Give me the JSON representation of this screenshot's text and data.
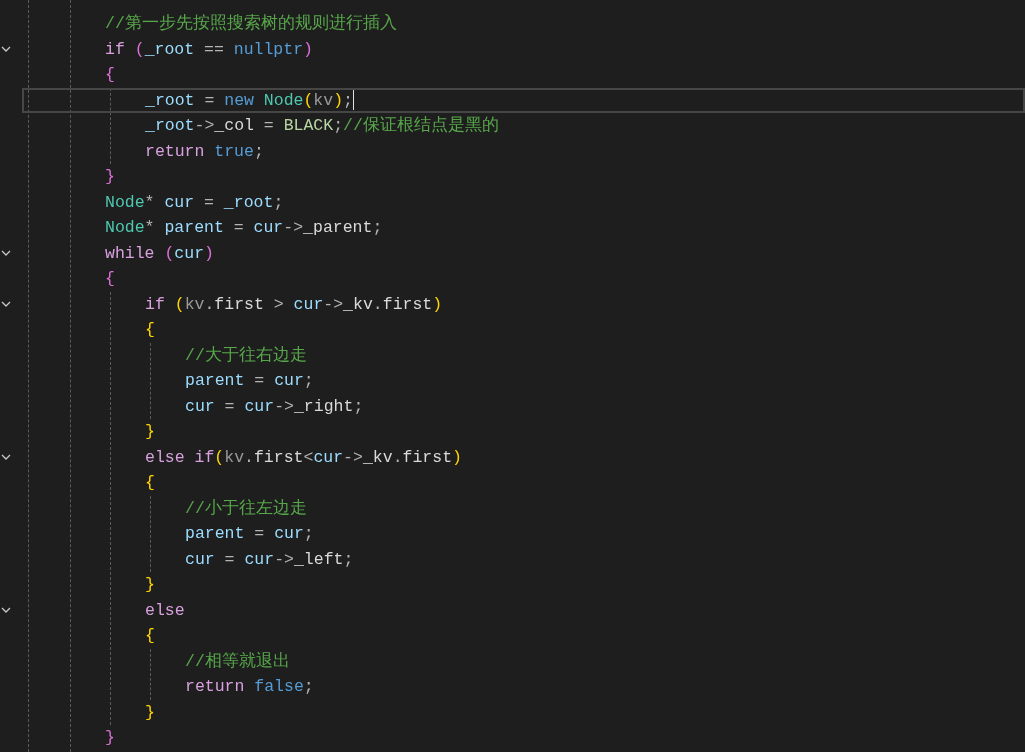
{
  "lines": [
    {
      "fold": false,
      "current": false,
      "tokens": [
        {
          "kind": "comment",
          "text": "//第一步先按照搜索树的规则进行插入"
        }
      ]
    },
    {
      "fold": true,
      "current": false,
      "tokens": [
        {
          "kind": "control",
          "text": "if "
        },
        {
          "kind": "bracket1",
          "text": "("
        },
        {
          "kind": "variable",
          "text": "_root"
        },
        {
          "kind": "punct",
          "text": " == "
        },
        {
          "kind": "keyword",
          "text": "nullptr"
        },
        {
          "kind": "bracket1",
          "text": ")"
        }
      ]
    },
    {
      "fold": false,
      "current": false,
      "tokens": [
        {
          "kind": "bracket1",
          "text": "{"
        }
      ],
      "children": [
        {
          "fold": false,
          "current": true,
          "tokens": [
            {
              "kind": "variable",
              "text": "_root"
            },
            {
              "kind": "punct",
              "text": " = "
            },
            {
              "kind": "keyword",
              "text": "new "
            },
            {
              "kind": "type",
              "text": "Node"
            },
            {
              "kind": "bracket2",
              "text": "("
            },
            {
              "kind": "param",
              "text": "kv"
            },
            {
              "kind": "bracket2",
              "text": ")"
            },
            {
              "kind": "punct",
              "text": ";"
            }
          ]
        },
        {
          "fold": false,
          "current": false,
          "tokens": [
            {
              "kind": "variable",
              "text": "_root"
            },
            {
              "kind": "punct",
              "text": "->"
            },
            {
              "kind": "member",
              "text": "_col"
            },
            {
              "kind": "punct",
              "text": " = "
            },
            {
              "kind": "enum",
              "text": "BLACK"
            },
            {
              "kind": "punct",
              "text": ";"
            },
            {
              "kind": "comment",
              "text": "//保证根结点是黑的"
            }
          ]
        },
        {
          "fold": false,
          "current": false,
          "tokens": [
            {
              "kind": "control",
              "text": "return "
            },
            {
              "kind": "keyword",
              "text": "true"
            },
            {
              "kind": "punct",
              "text": ";"
            }
          ]
        }
      ]
    },
    {
      "fold": false,
      "current": false,
      "tokens": [
        {
          "kind": "bracket1",
          "text": "}"
        }
      ]
    },
    {
      "fold": false,
      "current": false,
      "tokens": [
        {
          "kind": "type",
          "text": "Node"
        },
        {
          "kind": "punct",
          "text": "* "
        },
        {
          "kind": "variable",
          "text": "cur"
        },
        {
          "kind": "punct",
          "text": " = "
        },
        {
          "kind": "variable",
          "text": "_root"
        },
        {
          "kind": "punct",
          "text": ";"
        }
      ]
    },
    {
      "fold": false,
      "current": false,
      "tokens": [
        {
          "kind": "type",
          "text": "Node"
        },
        {
          "kind": "punct",
          "text": "* "
        },
        {
          "kind": "variable",
          "text": "parent"
        },
        {
          "kind": "punct",
          "text": " = "
        },
        {
          "kind": "variable",
          "text": "cur"
        },
        {
          "kind": "punct",
          "text": "->"
        },
        {
          "kind": "member",
          "text": "_parent"
        },
        {
          "kind": "punct",
          "text": ";"
        }
      ]
    },
    {
      "fold": true,
      "current": false,
      "tokens": [
        {
          "kind": "control",
          "text": "while "
        },
        {
          "kind": "bracket1",
          "text": "("
        },
        {
          "kind": "variable",
          "text": "cur"
        },
        {
          "kind": "bracket1",
          "text": ")"
        }
      ]
    },
    {
      "fold": false,
      "current": false,
      "tokens": [
        {
          "kind": "bracket1",
          "text": "{"
        }
      ],
      "children": [
        {
          "fold": true,
          "current": false,
          "tokens": [
            {
              "kind": "control",
              "text": "if "
            },
            {
              "kind": "bracket2",
              "text": "("
            },
            {
              "kind": "param",
              "text": "kv"
            },
            {
              "kind": "punct",
              "text": "."
            },
            {
              "kind": "member",
              "text": "first"
            },
            {
              "kind": "punct",
              "text": " > "
            },
            {
              "kind": "variable",
              "text": "cur"
            },
            {
              "kind": "punct",
              "text": "->"
            },
            {
              "kind": "member",
              "text": "_kv"
            },
            {
              "kind": "punct",
              "text": "."
            },
            {
              "kind": "member",
              "text": "first"
            },
            {
              "kind": "bracket2",
              "text": ")"
            }
          ]
        },
        {
          "fold": false,
          "current": false,
          "tokens": [
            {
              "kind": "bracket2",
              "text": "{"
            }
          ],
          "children": [
            {
              "fold": false,
              "current": false,
              "tokens": [
                {
                  "kind": "comment",
                  "text": "//大于往右边走"
                }
              ]
            },
            {
              "fold": false,
              "current": false,
              "tokens": [
                {
                  "kind": "variable",
                  "text": "parent"
                },
                {
                  "kind": "punct",
                  "text": " = "
                },
                {
                  "kind": "variable",
                  "text": "cur"
                },
                {
                  "kind": "punct",
                  "text": ";"
                }
              ]
            },
            {
              "fold": false,
              "current": false,
              "tokens": [
                {
                  "kind": "variable",
                  "text": "cur"
                },
                {
                  "kind": "punct",
                  "text": " = "
                },
                {
                  "kind": "variable",
                  "text": "cur"
                },
                {
                  "kind": "punct",
                  "text": "->"
                },
                {
                  "kind": "member",
                  "text": "_right"
                },
                {
                  "kind": "punct",
                  "text": ";"
                }
              ]
            }
          ]
        },
        {
          "fold": false,
          "current": false,
          "tokens": [
            {
              "kind": "bracket2",
              "text": "}"
            }
          ]
        },
        {
          "fold": true,
          "current": false,
          "tokens": [
            {
              "kind": "control",
              "text": "else "
            },
            {
              "kind": "control",
              "text": "if"
            },
            {
              "kind": "bracket2",
              "text": "("
            },
            {
              "kind": "param",
              "text": "kv"
            },
            {
              "kind": "punct",
              "text": "."
            },
            {
              "kind": "member",
              "text": "first"
            },
            {
              "kind": "punct",
              "text": "<"
            },
            {
              "kind": "variable",
              "text": "cur"
            },
            {
              "kind": "punct",
              "text": "->"
            },
            {
              "kind": "member",
              "text": "_kv"
            },
            {
              "kind": "punct",
              "text": "."
            },
            {
              "kind": "member",
              "text": "first"
            },
            {
              "kind": "bracket2",
              "text": ")"
            }
          ]
        },
        {
          "fold": false,
          "current": false,
          "tokens": [
            {
              "kind": "bracket2",
              "text": "{"
            }
          ],
          "children": [
            {
              "fold": false,
              "current": false,
              "tokens": [
                {
                  "kind": "comment",
                  "text": "//小于往左边走"
                }
              ]
            },
            {
              "fold": false,
              "current": false,
              "tokens": [
                {
                  "kind": "variable",
                  "text": "parent"
                },
                {
                  "kind": "punct",
                  "text": " = "
                },
                {
                  "kind": "variable",
                  "text": "cur"
                },
                {
                  "kind": "punct",
                  "text": ";"
                }
              ]
            },
            {
              "fold": false,
              "current": false,
              "tokens": [
                {
                  "kind": "variable",
                  "text": "cur"
                },
                {
                  "kind": "punct",
                  "text": " = "
                },
                {
                  "kind": "variable",
                  "text": "cur"
                },
                {
                  "kind": "punct",
                  "text": "->"
                },
                {
                  "kind": "member",
                  "text": "_left"
                },
                {
                  "kind": "punct",
                  "text": ";"
                }
              ]
            }
          ]
        },
        {
          "fold": false,
          "current": false,
          "tokens": [
            {
              "kind": "bracket2",
              "text": "}"
            }
          ]
        },
        {
          "fold": true,
          "current": false,
          "tokens": [
            {
              "kind": "control",
              "text": "else"
            }
          ]
        },
        {
          "fold": false,
          "current": false,
          "tokens": [
            {
              "kind": "bracket2",
              "text": "{"
            }
          ],
          "children": [
            {
              "fold": false,
              "current": false,
              "tokens": [
                {
                  "kind": "comment",
                  "text": "//相等就退出"
                }
              ]
            },
            {
              "fold": false,
              "current": false,
              "tokens": [
                {
                  "kind": "control",
                  "text": "return "
                },
                {
                  "kind": "keyword",
                  "text": "false"
                },
                {
                  "kind": "punct",
                  "text": ";"
                }
              ]
            }
          ]
        },
        {
          "fold": false,
          "current": false,
          "tokens": [
            {
              "kind": "bracket2",
              "text": "}"
            }
          ]
        }
      ]
    },
    {
      "fold": false,
      "current": false,
      "tokens": [
        {
          "kind": "bracket1",
          "text": "}"
        }
      ]
    }
  ]
}
